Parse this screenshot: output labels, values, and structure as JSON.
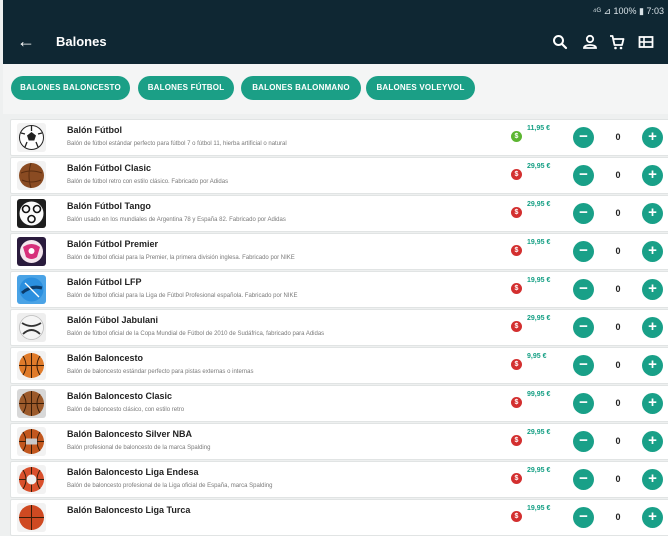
{
  "status": {
    "right_text": "⁴ᴳ ⊿ 100% ▮ 7:03"
  },
  "appbar": {
    "title": "Balones"
  },
  "categories": [
    "BALONES BALONCESTO",
    "BALONES FÚTBOL",
    "BALONES BALONMANO",
    "BALONES VOLEYVOL"
  ],
  "products": [
    {
      "name": "Balón Fútbol",
      "description": "Balón de fútbol estándar perfecto para fútbol 7 o fútbol 11, hierba artificial o natural",
      "badge": "$",
      "badge_color": "#5cb531",
      "price": "11,95 €",
      "qty": "0",
      "ball": "soccer"
    },
    {
      "name": "Balón Fútbol Clasic",
      "description": "Balón de fútbol retro con estilo clásico. Fabricado por Adidas",
      "badge": "$",
      "badge_color": "#d32f2f",
      "price": "29,95 €",
      "qty": "0",
      "ball": "leather"
    },
    {
      "name": "Balón Fútbol Tango",
      "description": "Balón usado en los mundiales de Argentina 78 y España 82. Fabricado por Adidas",
      "badge": "$",
      "badge_color": "#d32f2f",
      "price": "29,95 €",
      "qty": "0",
      "ball": "tango"
    },
    {
      "name": "Balón Fútbol Premier",
      "description": "Balón de fútbol oficial para la Premier, la primera división inglesa. Fabricado por NIKE",
      "badge": "$",
      "badge_color": "#d32f2f",
      "price": "19,95 €",
      "qty": "0",
      "ball": "premier"
    },
    {
      "name": "Balón Fútbol LFP",
      "description": "Balón de fútbol oficial para la Liga de Fútbol Profesional española. Fabricado por NIKE",
      "badge": "$",
      "badge_color": "#d32f2f",
      "price": "19,95 €",
      "qty": "0",
      "ball": "lfp"
    },
    {
      "name": "Balón Fúbol Jabulani",
      "description": "Balón de fútbol oficial de la Copa Mundial de Fútbol de 2010 de Sudáfrica, fabricado para Adidas",
      "badge": "$",
      "badge_color": "#d32f2f",
      "price": "29,95 €",
      "qty": "0",
      "ball": "jabulani"
    },
    {
      "name": "Balón Baloncesto",
      "description": "Balón de baloncesto estándar perfecto para pistas externas o internas",
      "badge": "$",
      "badge_color": "#d32f2f",
      "price": "9,95 €",
      "qty": "0",
      "ball": "basket"
    },
    {
      "name": "Balón Baloncesto Clasic",
      "description": "Balón de baloncesto clásico, con estilo retro",
      "badge": "$",
      "badge_color": "#d32f2f",
      "price": "99,95 €",
      "qty": "0",
      "ball": "basket-classic"
    },
    {
      "name": "Balón Baloncesto Silver NBA",
      "description": "Balón profesional de baloncesto de la marca Spalding",
      "badge": "$",
      "badge_color": "#d32f2f",
      "price": "29,95 €",
      "qty": "0",
      "ball": "basket-nba"
    },
    {
      "name": "Balón Baloncesto Liga Endesa",
      "description": "Balón de baloncesto profesional de la Liga oficial de España, marca Spalding",
      "badge": "$",
      "badge_color": "#d32f2f",
      "price": "29,95 €",
      "qty": "0",
      "ball": "basket-endesa"
    },
    {
      "name": "Balón Baloncesto Liga Turca",
      "description": "",
      "badge": "$",
      "badge_color": "#d32f2f",
      "price": "19,95 €",
      "qty": "0",
      "ball": "basket-turca"
    }
  ]
}
